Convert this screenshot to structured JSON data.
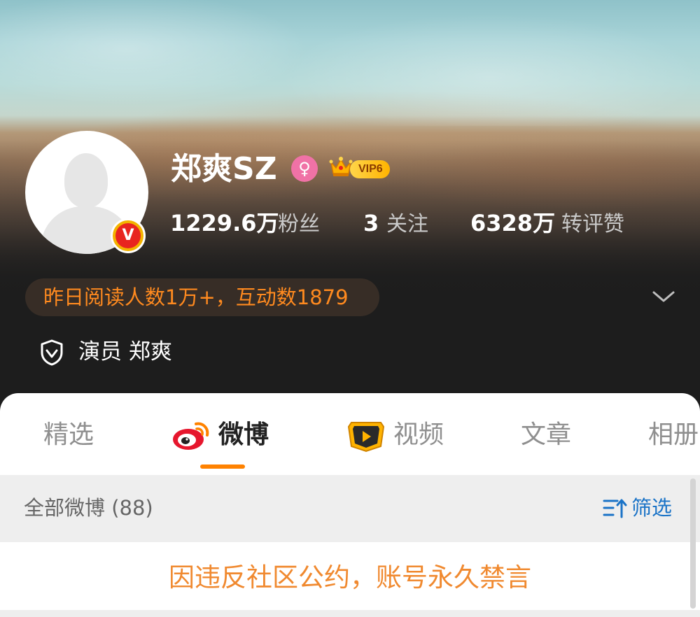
{
  "profile": {
    "name": "郑爽SZ",
    "gender_icon": "female-icon",
    "vip_label": "VIP6",
    "verified_badge": "V",
    "stats": {
      "followers_count": "1229.6万",
      "followers_label": "粉丝",
      "following_count": "3",
      "following_label": "关注",
      "interactions_count": "6328万",
      "interactions_label": "转评赞"
    },
    "daily_reads": "昨日阅读人数1万+，互动数1879",
    "verification": "演员 郑爽"
  },
  "tabs": [
    {
      "label": "精选",
      "active": false
    },
    {
      "label": "微博",
      "active": true,
      "icon": "weibo-icon"
    },
    {
      "label": "视频",
      "active": false,
      "icon": "video-icon"
    },
    {
      "label": "文章",
      "active": false
    },
    {
      "label": "相册",
      "active": false
    }
  ],
  "feed": {
    "title": "全部微博 (88)",
    "filter_label": "筛选",
    "notice": "因违反社区公约，账号永久禁言"
  },
  "colors": {
    "accent_orange": "#ff8200",
    "notice_orange": "#f0892f",
    "link_blue": "#1a73c7",
    "vip_gold": "#ffb300",
    "verified_red": "#e8251f",
    "female_pink": "#f072a6"
  }
}
